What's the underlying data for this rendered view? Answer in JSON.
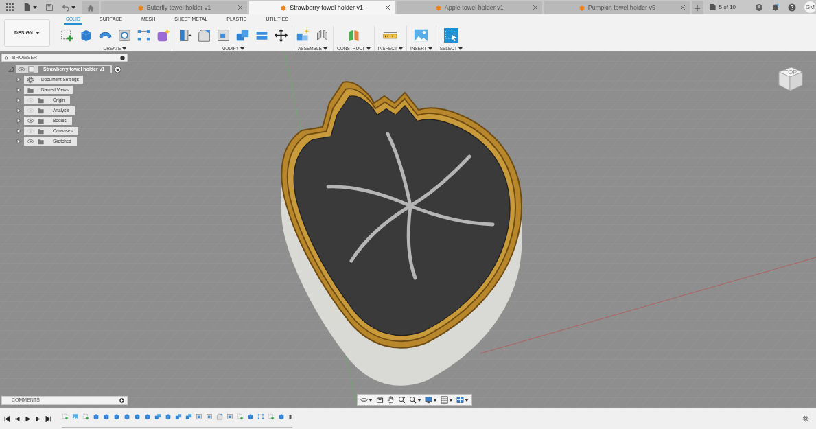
{
  "app_bar": {
    "tabs": [
      {
        "label": "Buterfly towel holder v1",
        "selected": false
      },
      {
        "label": "Strawberry towel holder v1",
        "selected": true
      },
      {
        "label": "Apple towel holder v1",
        "selected": false
      },
      {
        "label": "Pumpkin towel holder v5",
        "selected": false
      }
    ],
    "version_count": "5 of 10",
    "user_initials": "GM"
  },
  "toolbar": {
    "workspace": "DESIGN",
    "tabs": [
      {
        "label": "SOLID",
        "selected": true
      },
      {
        "label": "SURFACE",
        "selected": false
      },
      {
        "label": "MESH",
        "selected": false
      },
      {
        "label": "SHEET METAL",
        "selected": false
      },
      {
        "label": "PLASTIC",
        "selected": false
      },
      {
        "label": "UTILITIES",
        "selected": false
      }
    ],
    "groups": [
      {
        "label": "CREATE",
        "tools": [
          {
            "kind": "sketch"
          },
          {
            "kind": "extrude"
          },
          {
            "kind": "revolve"
          },
          {
            "kind": "hole"
          },
          {
            "kind": "pattern"
          },
          {
            "kind": "form"
          }
        ]
      },
      {
        "label": "MODIFY",
        "tools": [
          {
            "kind": "presspull"
          },
          {
            "kind": "fillet"
          },
          {
            "kind": "shell"
          },
          {
            "kind": "combine"
          },
          {
            "kind": "replace"
          },
          {
            "kind": "move"
          }
        ]
      },
      {
        "label": "ASSEMBLE",
        "tools": [
          {
            "kind": "joint"
          },
          {
            "kind": "asbuilt"
          }
        ]
      },
      {
        "label": "CONSTRUCT",
        "tools": [
          {
            "kind": "plane"
          }
        ]
      },
      {
        "label": "INSPECT",
        "tools": [
          {
            "kind": "measure"
          }
        ]
      },
      {
        "label": "INSERT",
        "tools": [
          {
            "kind": "image"
          }
        ]
      },
      {
        "label": "SELECT",
        "tools": [
          {
            "kind": "select"
          }
        ]
      }
    ]
  },
  "browser": {
    "title": "BROWSER",
    "root": {
      "label": "Strawberry towel holder v1",
      "visible": true,
      "children": [
        {
          "label": "Document Settings",
          "kind": "settings"
        },
        {
          "label": "Named Views",
          "kind": "folder"
        },
        {
          "label": "Origin",
          "kind": "folder",
          "visible": false
        },
        {
          "label": "Analysis",
          "kind": "folder",
          "visible": false
        },
        {
          "label": "Bodies",
          "kind": "folder",
          "visible": true
        },
        {
          "label": "Canvases",
          "kind": "folder",
          "visible": false
        },
        {
          "label": "Sketches",
          "kind": "folder",
          "visible": true
        }
      ]
    }
  },
  "view_cube": {
    "face": "TOP"
  },
  "comments": {
    "title": "COMMENTS"
  },
  "nav_bar": {
    "tools": [
      {
        "kind": "orbit",
        "dropdown": true
      },
      {
        "kind": "lookat",
        "dropdown": false
      },
      {
        "kind": "pan",
        "dropdown": false
      },
      {
        "kind": "zoom",
        "dropdown": false
      },
      {
        "kind": "fit",
        "dropdown": true
      },
      {
        "kind": "display",
        "dropdown": true
      },
      {
        "kind": "grid",
        "dropdown": true
      },
      {
        "kind": "viewports",
        "dropdown": true
      }
    ]
  },
  "timeline": {
    "features": [
      {
        "kind": "sketch"
      },
      {
        "kind": "canvas"
      },
      {
        "kind": "sketch"
      },
      {
        "kind": "extrude"
      },
      {
        "kind": "extrude"
      },
      {
        "kind": "extrude"
      },
      {
        "kind": "extrude"
      },
      {
        "kind": "extrude"
      },
      {
        "kind": "extrude"
      },
      {
        "kind": "combine"
      },
      {
        "kind": "extrude"
      },
      {
        "kind": "combine"
      },
      {
        "kind": "combine"
      },
      {
        "kind": "shell"
      },
      {
        "kind": "shell"
      },
      {
        "kind": "fillet"
      },
      {
        "kind": "shell"
      },
      {
        "kind": "sketch"
      },
      {
        "kind": "extrude"
      },
      {
        "kind": "pattern"
      },
      {
        "kind": "sketch"
      },
      {
        "kind": "extrude"
      }
    ]
  }
}
